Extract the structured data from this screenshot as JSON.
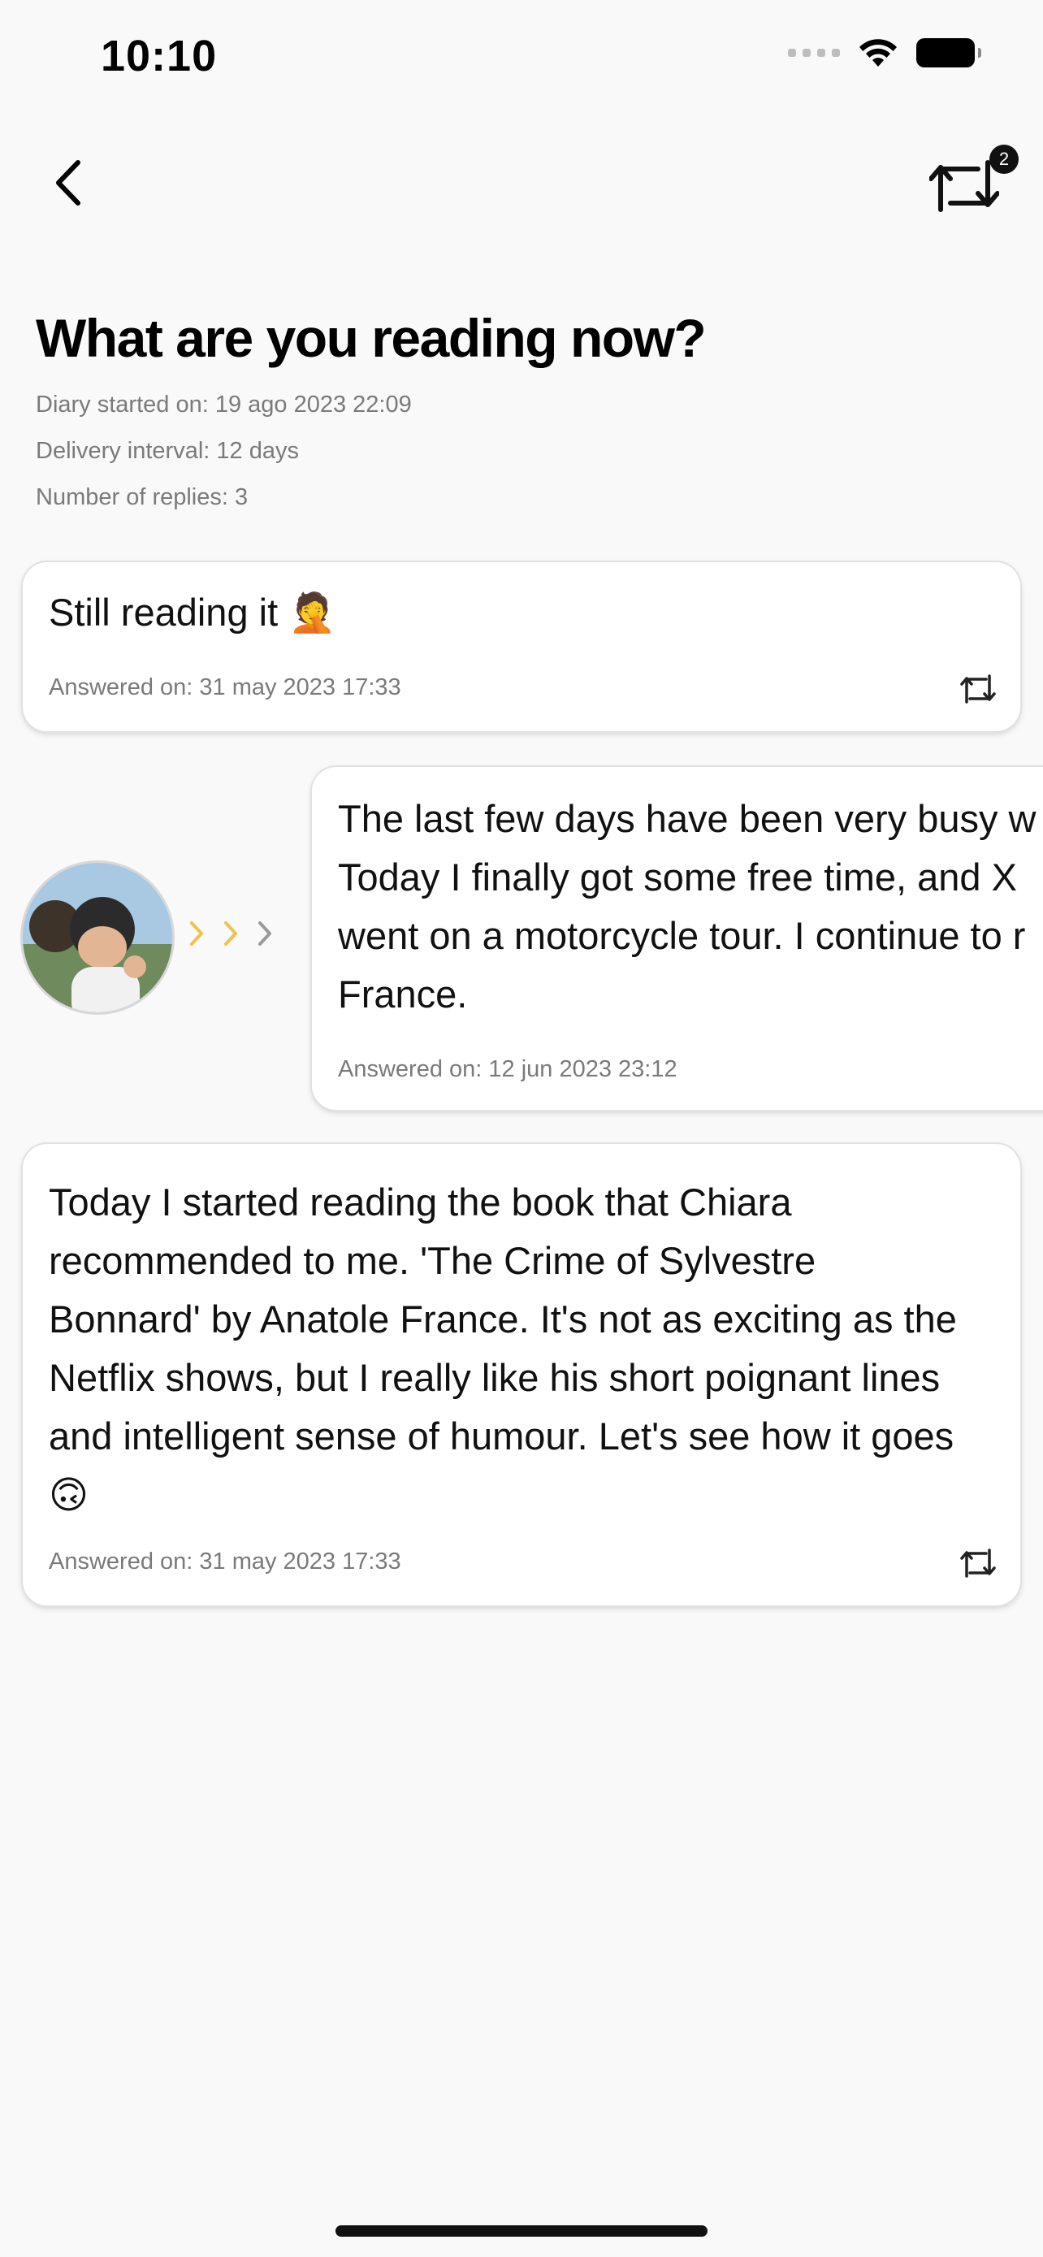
{
  "status_bar": {
    "time": "10:10"
  },
  "header": {
    "back_icon": "chevron-left-icon",
    "repeat_icon": "repeat-icon",
    "repeat_badge": "2"
  },
  "diary": {
    "title": "What are you reading now?",
    "started_on": "Diary started on: 19 ago 2023 22:09",
    "delivery_interval": "Delivery interval: 12 days",
    "replies": "Number of replies: 3"
  },
  "entries": [
    {
      "text": "Still reading it 🤦",
      "date": "Answered on: 31 may 2023 17:33"
    },
    {
      "lines": [
        "The last few days have been very busy w",
        "Today I finally got some free time, and X",
        "went on a motorcycle tour. I continue to r",
        "France."
      ],
      "date": "Answered on: 12 jun 2023 23:12"
    },
    {
      "lines": [
        "Today I started reading the book that Chiara",
        "recommended to me. 'The Crime of Sylvestre",
        "Bonnard' by Anatole France. It's not as exciting as the",
        "Netflix shows, but I really like his short poignant lines",
        "and intelligent sense of humour. Let's see how it goes",
        "🙃"
      ],
      "date": "Answered on: 31 may 2023 17:33"
    }
  ],
  "colors": {
    "chevron_active": "#f0c24a",
    "chevron_inactive": "#9a9a9a",
    "meta_text": "#7a7a7a"
  }
}
